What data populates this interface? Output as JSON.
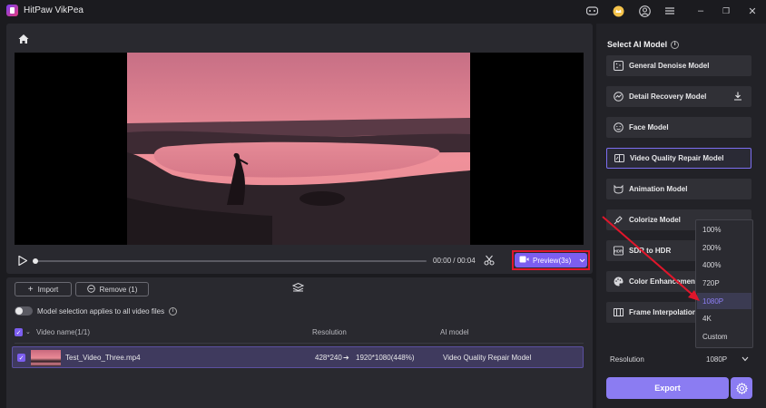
{
  "app": {
    "title": "HitPaw VikPea"
  },
  "window_controls": {
    "minimize": "–",
    "maximize": "❐",
    "close": "✕"
  },
  "player": {
    "time": "00:00 / 00:04",
    "preview_label": "Preview(3s)",
    "progress": 0
  },
  "file_panel": {
    "import_label": "Import",
    "remove_label": "Remove (1)",
    "toggle_label": "Model selection applies to all video files",
    "columns": {
      "name": "Video name(1/1)",
      "resolution": "Resolution",
      "model": "AI model"
    },
    "rows": [
      {
        "name": "Test_Video_Three.mp4",
        "from_res": "428*240",
        "to_res": "1920*1080(448%)",
        "model": "Video Quality Repair Model"
      }
    ]
  },
  "right_panel": {
    "title": "Select AI Model",
    "models": [
      {
        "label": "General Denoise Model",
        "icon": "denoise-icon"
      },
      {
        "label": "Detail Recovery Model",
        "icon": "detail-icon"
      },
      {
        "label": "Face Model",
        "icon": "face-icon"
      },
      {
        "label": "Video Quality Repair Model",
        "icon": "repair-icon"
      },
      {
        "label": "Animation Model",
        "icon": "animation-icon"
      },
      {
        "label": "Colorize Model",
        "icon": "colorize-icon"
      },
      {
        "label": "SDR to HDR",
        "icon": "hdr-icon"
      },
      {
        "label": "Color Enhancement",
        "icon": "palette-icon"
      },
      {
        "label": "Frame Interpolation",
        "icon": "frame-icon"
      }
    ],
    "resolution_label": "Resolution",
    "resolution_value": "1080P",
    "export_label": "Export"
  },
  "resolution_options": [
    "100%",
    "200%",
    "400%",
    "720P",
    "1080P",
    "4K",
    "Custom"
  ],
  "colors": {
    "accent": "#7c5ef0",
    "highlight": "#e0162b",
    "panel": "#29292f"
  }
}
